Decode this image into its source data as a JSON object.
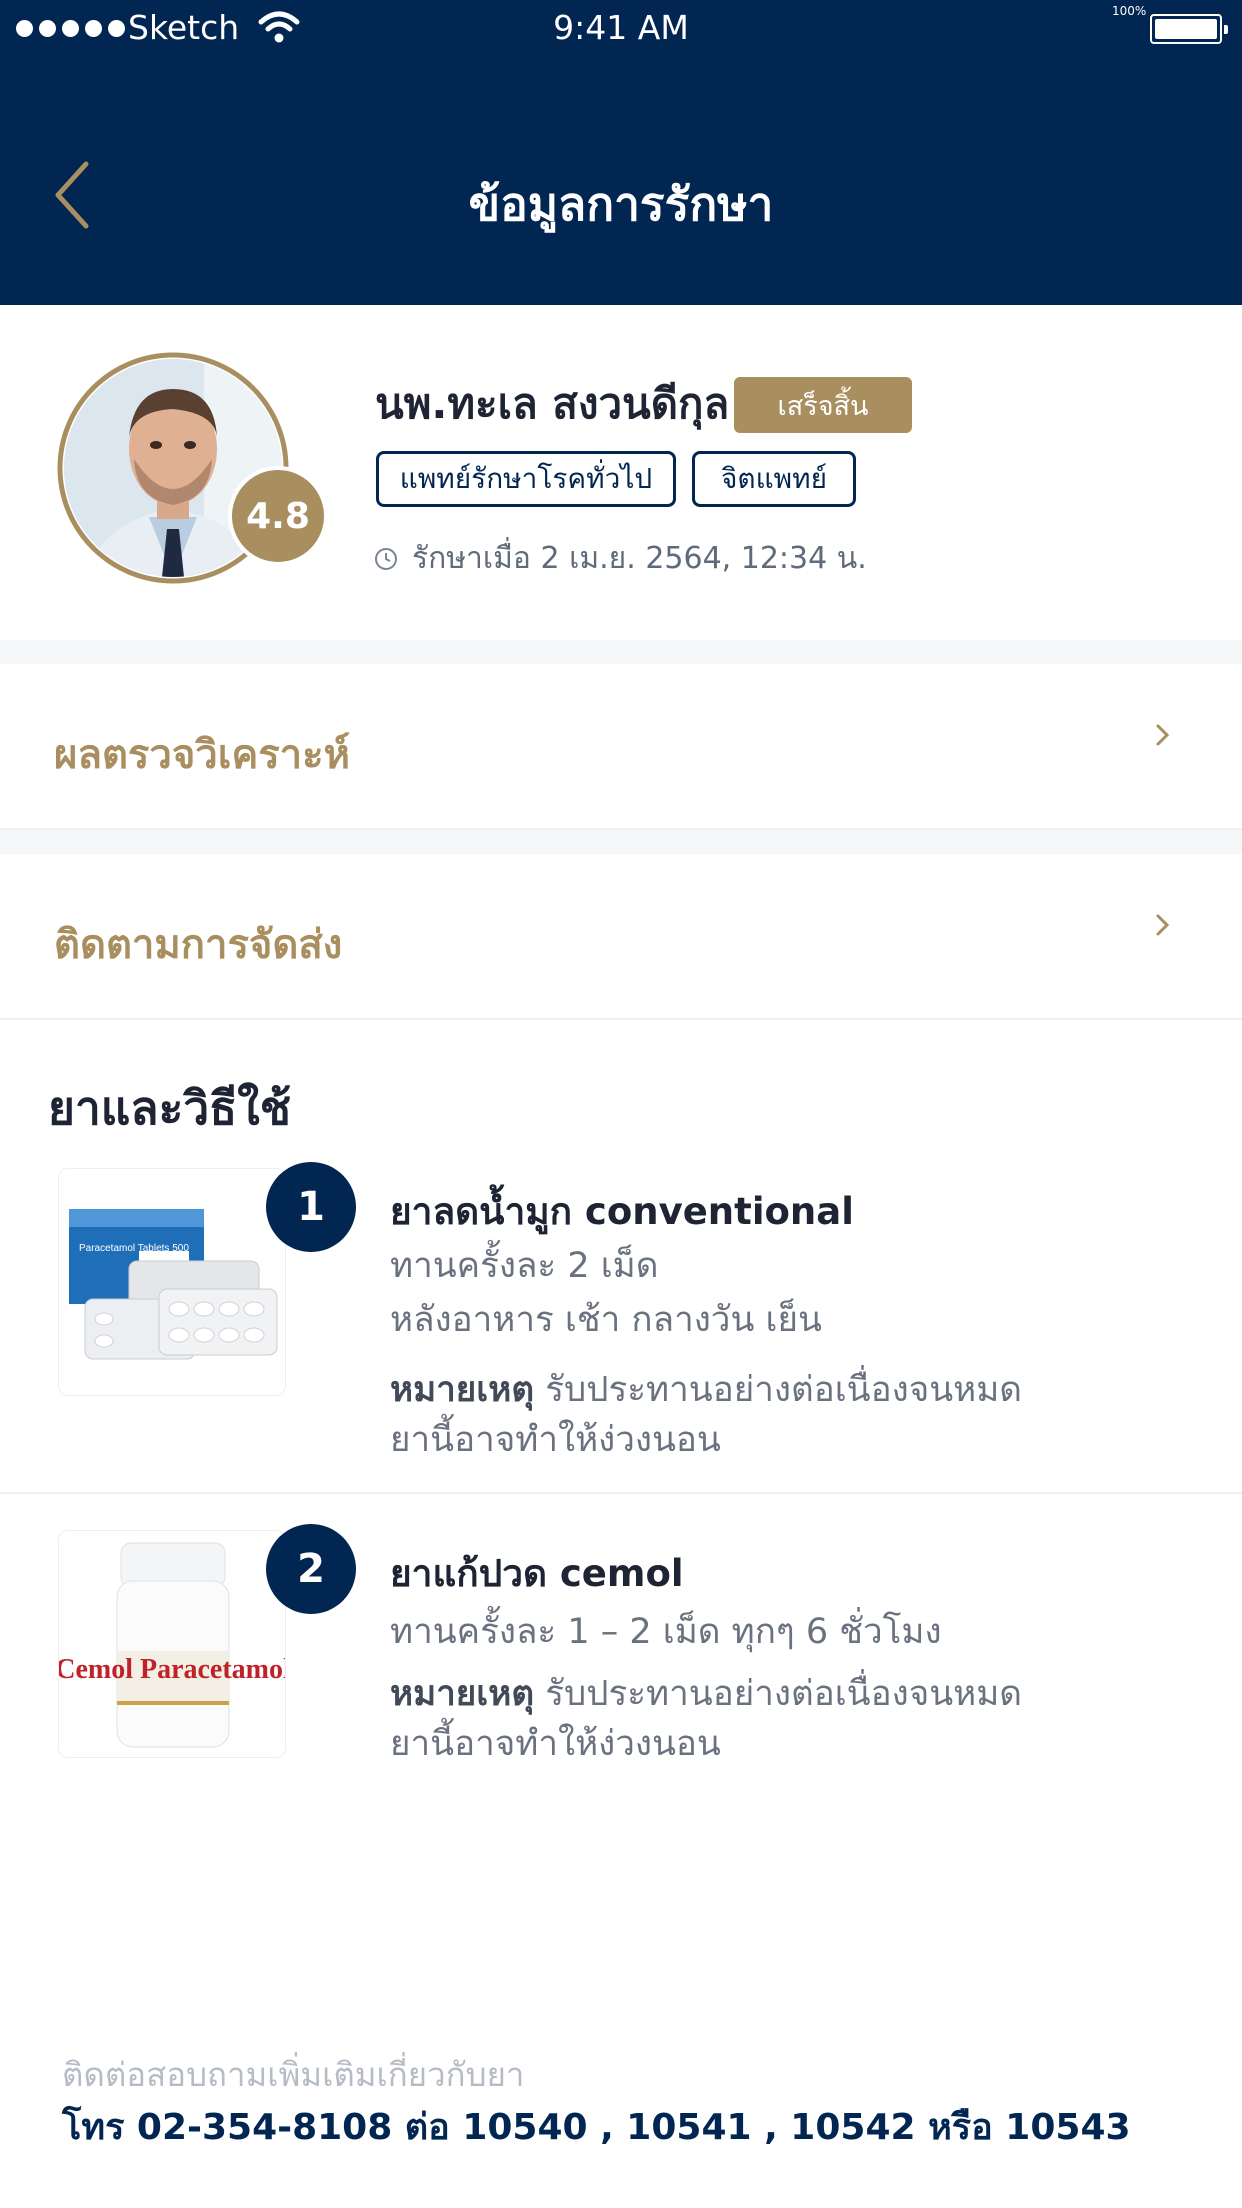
{
  "status_bar": {
    "carrier": "Sketch",
    "time": "9:41 AM",
    "battery": "100%"
  },
  "header": {
    "title": "ข้อมูลการรักษา"
  },
  "doctor": {
    "name": "นพ.ทะเล สงวนดีกุล",
    "status": "เสร็จสิ้น",
    "rating": "4.8",
    "tags": [
      "แพทย์รักษาโรคทั่วไป",
      "จิตแพทย์"
    ],
    "treatment_date": "รักษาเมื่อ 2 เม.ย. 2564, 12:34 น."
  },
  "rows": [
    {
      "label": "ผลตรวจวิเคราะห์"
    },
    {
      "label": "ติดตามการจัดส่ง"
    }
  ],
  "medications": {
    "title": "ยาและวิธีใช้",
    "items": [
      {
        "number": "1",
        "name": "ยาลดน้ำมูก conventional",
        "dosage": "ทานครั้งละ 2 เม็ด",
        "timing": "หลังอาหาร เช้า กลางวัน เย็น",
        "note_label": "หมายเหตุ",
        "note_text": "รับประทานอย่างต่อเนื่องจนหมด",
        "note_line2": "ยานี้อาจทำให้ง่วงนอน",
        "image_text": "Paracetamol Tablets 500"
      },
      {
        "number": "2",
        "name": "ยาแก้ปวด cemol",
        "dosage": "ทานครั้งละ 1 – 2 เม็ด ทุกๆ 6 ชั่วโมง",
        "note_label": "หมายเหตุ",
        "note_text": "รับประทานอย่างต่อเนื่องจนหมด",
        "note_line2": "ยานี้อาจทำให้ง่วงนอน",
        "image_text": "Cemol Paracetamol"
      }
    ]
  },
  "footer": {
    "contact_label": "ติดต่อสอบถามเพิ่มเติมเกี่ยวกับยา",
    "contact_phone": "โทร 02-354-8108 ต่อ 10540 , 10541 , 10542  หรือ 10543"
  },
  "colors": {
    "navy": "#022652",
    "gold": "#a98f5f"
  }
}
